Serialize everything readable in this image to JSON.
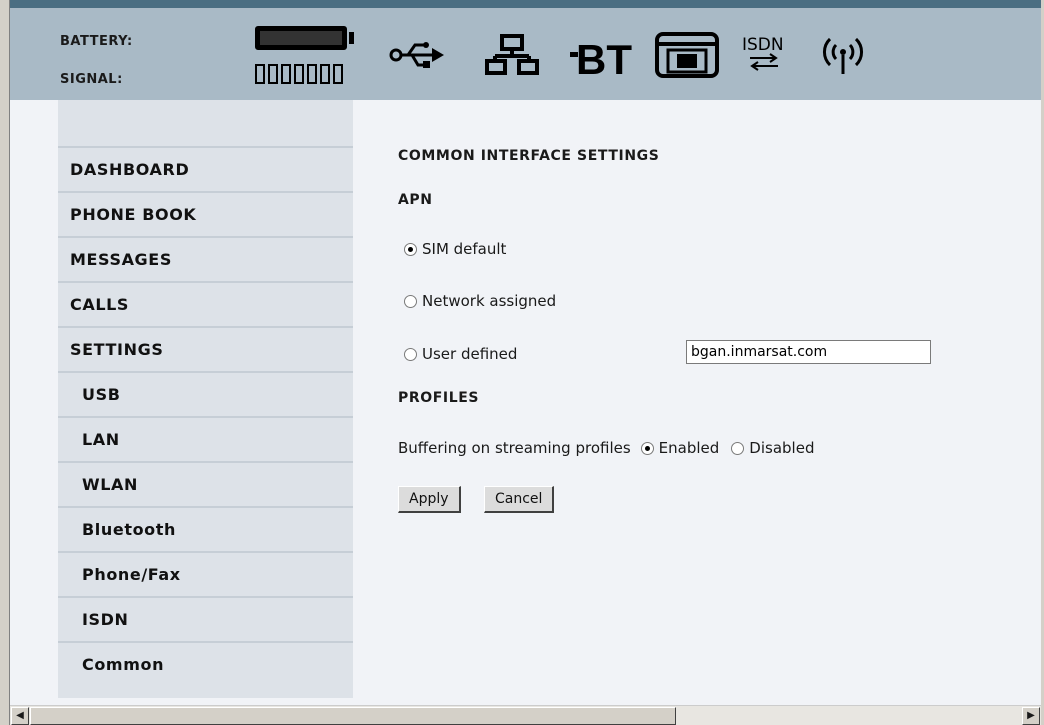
{
  "header": {
    "battery_label": "BATTERY:",
    "signal_label": "SIGNAL:",
    "status_icons": [
      "usb-icon",
      "lan-icon",
      "bluetooth-icon",
      "phone-fax-icon",
      "isdn-icon",
      "wlan-icon"
    ],
    "bt_text": "BT",
    "isdn_text": "ISDN",
    "signal_bars": 7
  },
  "sidebar": {
    "items": [
      {
        "label": "DASHBOARD",
        "sub": false
      },
      {
        "label": "PHONE BOOK",
        "sub": false
      },
      {
        "label": "MESSAGES",
        "sub": false
      },
      {
        "label": "CALLS",
        "sub": false
      },
      {
        "label": "SETTINGS",
        "sub": false
      },
      {
        "label": "USB",
        "sub": true
      },
      {
        "label": "LAN",
        "sub": true
      },
      {
        "label": "WLAN",
        "sub": true
      },
      {
        "label": "Bluetooth",
        "sub": true
      },
      {
        "label": "Phone/Fax",
        "sub": true
      },
      {
        "label": "ISDN",
        "sub": true
      },
      {
        "label": "Common",
        "sub": true
      }
    ]
  },
  "main": {
    "title": "COMMON INTERFACE SETTINGS",
    "apn": {
      "heading": "APN",
      "options": [
        "SIM default",
        "Network assigned",
        "User defined"
      ],
      "selected": "SIM default",
      "user_defined_value": "bgan.inmarsat.com"
    },
    "profiles": {
      "heading": "PROFILES",
      "buffering_label": "Buffering on streaming profiles",
      "enabled_label": "Enabled",
      "disabled_label": "Disabled",
      "selected": "Enabled"
    },
    "apply_label": "Apply",
    "cancel_label": "Cancel"
  },
  "colors": {
    "header_bg": "#a9bac6",
    "top_bar": "#4a6e82",
    "sidebar_bg": "#dde2e8",
    "content_bg": "#f1f3f7"
  }
}
